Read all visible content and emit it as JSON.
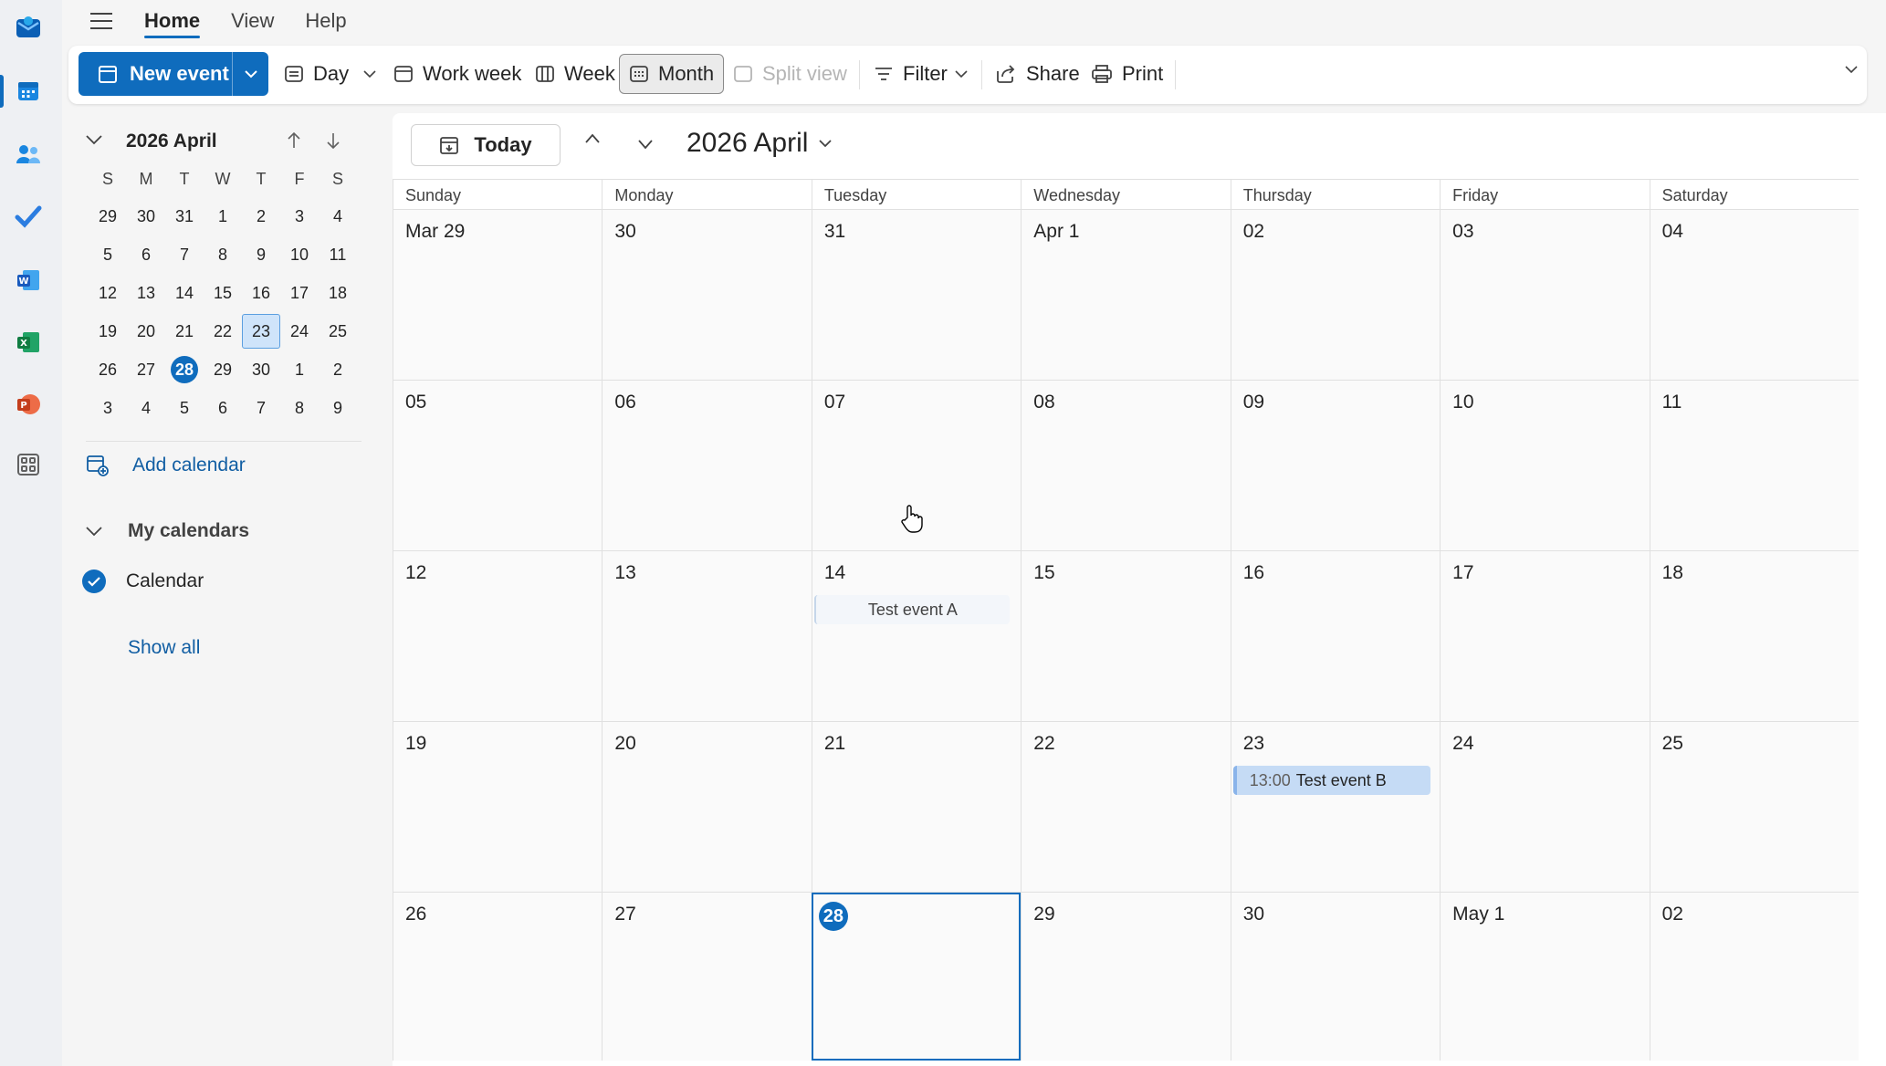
{
  "menu": {
    "tabs": [
      {
        "label": "Home",
        "active": true
      },
      {
        "label": "View",
        "active": false
      },
      {
        "label": "Help",
        "active": false
      }
    ]
  },
  "ribbon": {
    "new_event": "New event",
    "day": "Day",
    "work_week": "Work week",
    "week": "Week",
    "month": "Month",
    "split_view": "Split view",
    "filter": "Filter",
    "share": "Share",
    "print": "Print",
    "selected_view": "Month"
  },
  "mini_calendar": {
    "title": "2026 April",
    "dow": [
      "S",
      "M",
      "T",
      "W",
      "T",
      "F",
      "S"
    ],
    "weeks": [
      [
        "29",
        "30",
        "31",
        "1",
        "2",
        "3",
        "4"
      ],
      [
        "5",
        "6",
        "7",
        "8",
        "9",
        "10",
        "11"
      ],
      [
        "12",
        "13",
        "14",
        "15",
        "16",
        "17",
        "18"
      ],
      [
        "19",
        "20",
        "21",
        "22",
        "23",
        "24",
        "25"
      ],
      [
        "26",
        "27",
        "28",
        "29",
        "30",
        "1",
        "2"
      ],
      [
        "3",
        "4",
        "5",
        "6",
        "7",
        "8",
        "9"
      ]
    ],
    "today": "28",
    "selected": "23"
  },
  "sidebar": {
    "add_calendar": "Add calendar",
    "my_calendars": "My calendars",
    "calendar": "Calendar",
    "show_all": "Show all"
  },
  "main": {
    "today_button": "Today",
    "month_title": "2026 April",
    "dow": [
      "Sunday",
      "Monday",
      "Tuesday",
      "Wednesday",
      "Thursday",
      "Friday",
      "Saturday"
    ],
    "weeks": [
      [
        "Mar 29",
        "30",
        "31",
        "Apr 1",
        "02",
        "03",
        "04"
      ],
      [
        "05",
        "06",
        "07",
        "08",
        "09",
        "10",
        "11"
      ],
      [
        "12",
        "13",
        "14",
        "15",
        "16",
        "17",
        "18"
      ],
      [
        "19",
        "20",
        "21",
        "22",
        "23",
        "24",
        "25"
      ],
      [
        "26",
        "27",
        "28",
        "29",
        "30",
        "May 1",
        "02"
      ]
    ],
    "today": "28",
    "events": {
      "a": {
        "title": "Test event A",
        "day": "14"
      },
      "b": {
        "time": "13:00",
        "title": "Test event B",
        "day": "23"
      }
    }
  },
  "colors": {
    "accent": "#0f6cbd",
    "event_b_bg": "#c5dbf5",
    "mini_selected_bg": "#cfe4fa"
  },
  "rail_icons": [
    "outlook-icon",
    "calendar-icon",
    "people-icon",
    "todo-icon",
    "word-icon",
    "excel-icon",
    "powerpoint-icon",
    "more-apps-icon"
  ]
}
